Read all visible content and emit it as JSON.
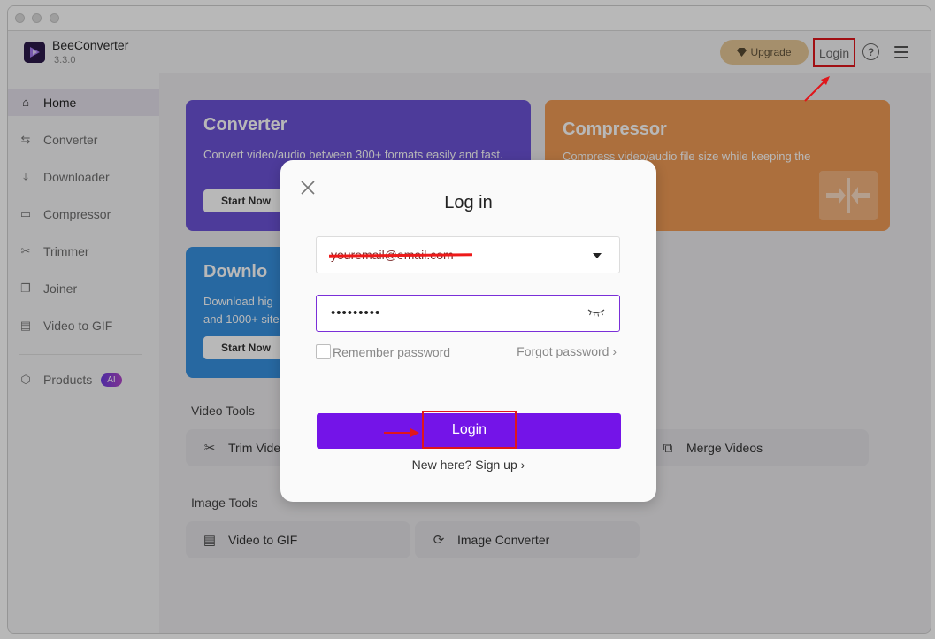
{
  "app": {
    "name": "BeeConverter",
    "version": "3.3.0",
    "upgrade_label": "Upgrade",
    "login_label": "Login",
    "help_icon": "question-icon",
    "menu_icon": "hamburger-icon",
    "accent_color": "#7414e8"
  },
  "sidebar": {
    "items": [
      {
        "label": "Home",
        "icon": "home-icon",
        "active": true
      },
      {
        "label": "Converter",
        "icon": "converter-icon"
      },
      {
        "label": "Downloader",
        "icon": "download-icon"
      },
      {
        "label": "Compressor",
        "icon": "compress-icon"
      },
      {
        "label": "Trimmer",
        "icon": "scissors-icon"
      },
      {
        "label": "Joiner",
        "icon": "joiner-icon"
      },
      {
        "label": "Video to GIF",
        "icon": "gif-icon"
      }
    ],
    "products_label": "Products",
    "ai_badge": "AI"
  },
  "cards": {
    "converter": {
      "title": "Converter",
      "desc": "Convert video/audio between 300+ formats easily and fast.",
      "button": "Start Now",
      "color": "#6b53d6"
    },
    "compressor": {
      "title": "Compressor",
      "desc": "Compress video/audio file size while keeping the",
      "color": "#ef9a55"
    },
    "downloader": {
      "title": "Downlo",
      "desc_line1": "Download hig",
      "desc_line2": "and 1000+ site",
      "button": "Start Now",
      "color": "#3790e0"
    }
  },
  "video_tools": {
    "title": "Video Tools",
    "items": [
      {
        "label": "Trim Vide",
        "icon": "scissors-icon"
      },
      {
        "label": "Merge Videos",
        "icon": "merge-icon"
      }
    ]
  },
  "image_tools": {
    "title": "Image Tools",
    "items": [
      {
        "label": "Video to GIF",
        "icon": "gif-icon"
      },
      {
        "label": "Image Converter",
        "icon": "refresh-icon"
      }
    ]
  },
  "login_dialog": {
    "title": "Log in",
    "email_value": "youremail@email.com",
    "password_value": "•••••••••",
    "remember_label": "Remember password",
    "forgot_label": "Forgot password",
    "forgot_chevron": "›",
    "login_button": "Login",
    "signup_label": "New here? Sign up",
    "signup_chevron": "›"
  }
}
